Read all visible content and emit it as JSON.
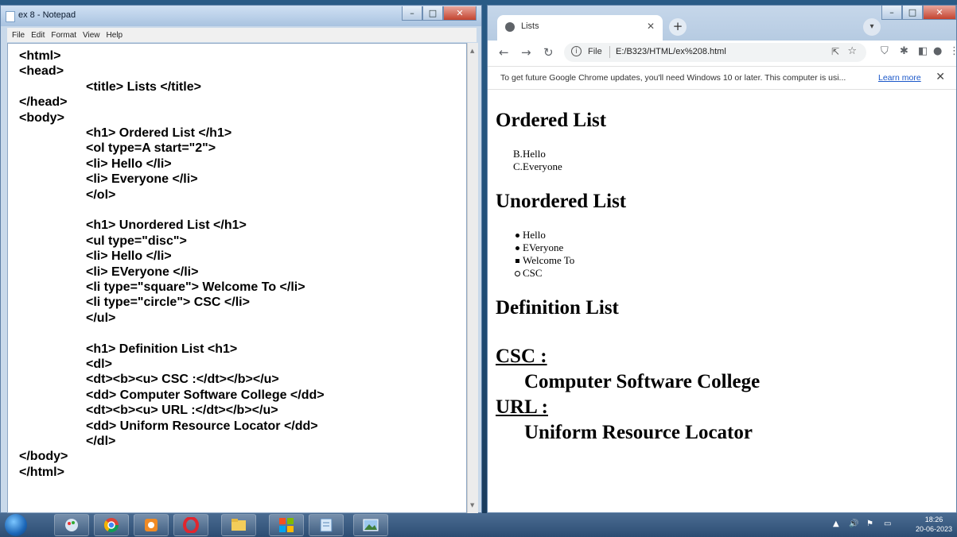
{
  "notepad": {
    "title": "ex 8 - Notepad",
    "menu": [
      "File",
      "Edit",
      "Format",
      "View",
      "Help"
    ],
    "code_lines": [
      {
        "indent": 0,
        "text": "<html>"
      },
      {
        "indent": 0,
        "text": "<head>"
      },
      {
        "indent": 1,
        "text": "<title> Lists </title>"
      },
      {
        "indent": 0,
        "text": "</head>"
      },
      {
        "indent": 0,
        "text": "<body>"
      },
      {
        "indent": 1,
        "text": "<h1> Ordered List </h1>"
      },
      {
        "indent": 1,
        "text": "<ol type=A start=\"2\">"
      },
      {
        "indent": 1,
        "text": "<li> Hello </li>"
      },
      {
        "indent": 1,
        "text": "<li> Everyone </li>"
      },
      {
        "indent": 1,
        "text": "</ol>"
      },
      {
        "indent": 1,
        "text": ""
      },
      {
        "indent": 1,
        "text": "<h1> Unordered List </h1>"
      },
      {
        "indent": 1,
        "text": "<ul type=\"disc\">"
      },
      {
        "indent": 1,
        "text": "<li> Hello </li>"
      },
      {
        "indent": 1,
        "text": "<li> EVeryone </li>"
      },
      {
        "indent": 1,
        "text": "<li type=\"square\"> Welcome To </li>"
      },
      {
        "indent": 1,
        "text": "<li type=\"circle\"> CSC </li>"
      },
      {
        "indent": 1,
        "text": "</ul>"
      },
      {
        "indent": 1,
        "text": ""
      },
      {
        "indent": 1,
        "text": "<h1> Definition List <h1>"
      },
      {
        "indent": 1,
        "text": "<dl>"
      },
      {
        "indent": 1,
        "text": "<dt><b><u> CSC :</dt></b></u>"
      },
      {
        "indent": 1,
        "text": "<dd> Computer Software College </dd>"
      },
      {
        "indent": 1,
        "text": "<dt><b><u> URL :</dt></b></u>"
      },
      {
        "indent": 1,
        "text": "<dd> Uniform Resource Locator </dd>"
      },
      {
        "indent": 1,
        "text": "</dl>"
      },
      {
        "indent": 0,
        "text": "</body>"
      },
      {
        "indent": 0,
        "text": "</html>"
      }
    ]
  },
  "browser": {
    "tab_title": "Lists",
    "url_scheme": "File",
    "url": "E:/B323/HTML/ex%208.html",
    "infobar_message": "To get future Google Chrome updates, you'll need Windows 10 or later. This computer is usi...",
    "infobar_link": "Learn more",
    "page": {
      "ordered_heading": "Ordered List",
      "ordered_items": [
        {
          "marker": "B.",
          "text": "Hello"
        },
        {
          "marker": "C.",
          "text": "Everyone"
        }
      ],
      "unordered_heading": "Unordered List",
      "unordered_items": [
        {
          "marker": "disc",
          "text": "Hello"
        },
        {
          "marker": "disc",
          "text": "EVeryone"
        },
        {
          "marker": "square",
          "text": "Welcome To"
        },
        {
          "marker": "circle",
          "text": "CSC"
        }
      ],
      "definition_heading": "Definition List",
      "definitions": [
        {
          "term": "CSC :",
          "description": "Computer Software College"
        },
        {
          "term": "URL :",
          "description": "Uniform Resource Locator"
        }
      ]
    }
  },
  "taskbar": {
    "time": "18:26",
    "date": "20-06-2023"
  },
  "colors": {
    "link": "#1a57c9",
    "close_button": "#c3432f",
    "taskbar": "#2c4d73"
  }
}
